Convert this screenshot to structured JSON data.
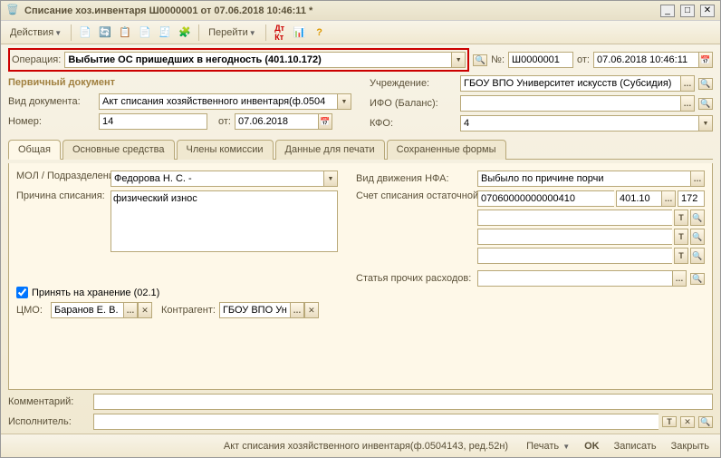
{
  "window": {
    "title": "Списание хоз.инвентаря Ш0000001 от 07.06.2018 10:46:11 *"
  },
  "toolbar": {
    "actions": "Действия",
    "goto": "Перейти"
  },
  "operation": {
    "label": "Операция:",
    "value": "Выбытие ОС пришедших в негодность (401.10.172)",
    "num_label": "№:",
    "num": "Ш0000001",
    "from_label": "от:",
    "date": "07.06.2018 10:46:11"
  },
  "primary_title": "Первичный документ",
  "left": {
    "doc_type_label": "Вид документа:",
    "doc_type": "Акт списания хозяйственного инвентаря(ф.0504",
    "number_label": "Номер:",
    "number": "14",
    "from_label": "от:",
    "date": "07.06.2018"
  },
  "right": {
    "org_label": "Учреждение:",
    "org": "ГБОУ ВПО Университет искусств (Субсидия)",
    "ifo_label": "ИФО (Баланс):",
    "ifo": "",
    "kfo_label": "КФО:",
    "kfo": "4"
  },
  "tabs": [
    "Общая",
    "Основные средства",
    "Члены комиссии",
    "Данные для печати",
    "Сохраненные формы"
  ],
  "general": {
    "mol_label": "МОЛ / Подразделение :",
    "mol": "Федорова Н. С. -",
    "reason_label": "Причина списания:",
    "reason": "физический износ",
    "take_storage": "Принять на хранение (02.1)",
    "cmo_label": "ЦМО:",
    "cmo": "Баранов Е. В.",
    "contragent_label": "Контрагент:",
    "contragent": "ГБОУ ВПО Ун",
    "nfa_label": "Вид движения НФА:",
    "nfa": "Выбыло по причине порчи",
    "acc_label": "Счет списания остаточной стоимости:",
    "acc1": "07060000000000410",
    "acc2": "401.10",
    "acc3": "172",
    "expense_label": "Статья прочих расходов:"
  },
  "bottom": {
    "comment_label": "Комментарий:",
    "performer_label": "Исполнитель:"
  },
  "footer": {
    "hint": "Акт списания хозяйственного инвентаря(ф.0504143, ред.52н)",
    "print": "Печать",
    "ok": "OK",
    "save": "Записать",
    "close": "Закрыть"
  }
}
